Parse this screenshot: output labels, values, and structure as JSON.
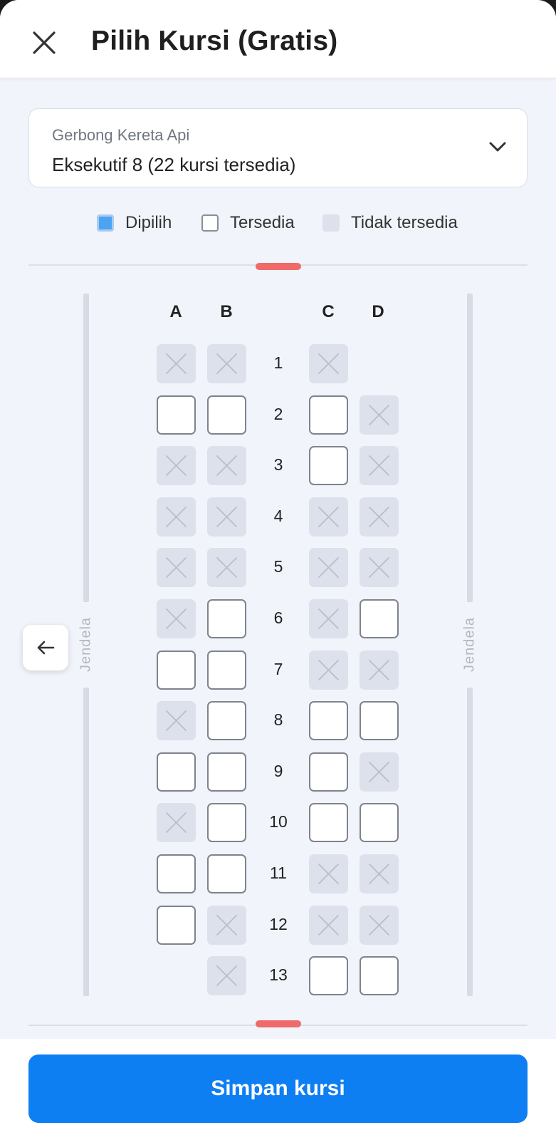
{
  "header": {
    "title": "Pilih Kursi (Gratis)"
  },
  "coach_select": {
    "label": "Gerbong Kereta Api",
    "value": "Eksekutif 8 (22 kursi tersedia)"
  },
  "legend": {
    "selected": "Dipilih",
    "available": "Tersedia",
    "unavailable": "Tidak tersedia"
  },
  "window_label": "Jendela",
  "columns": [
    "A",
    "B",
    "C",
    "D"
  ],
  "rows": [
    {
      "num": "1",
      "seats": [
        "unavailable",
        "unavailable",
        "unavailable",
        "none"
      ]
    },
    {
      "num": "2",
      "seats": [
        "available",
        "available",
        "available",
        "unavailable"
      ]
    },
    {
      "num": "3",
      "seats": [
        "unavailable",
        "unavailable",
        "available",
        "unavailable"
      ]
    },
    {
      "num": "4",
      "seats": [
        "unavailable",
        "unavailable",
        "unavailable",
        "unavailable"
      ]
    },
    {
      "num": "5",
      "seats": [
        "unavailable",
        "unavailable",
        "unavailable",
        "unavailable"
      ]
    },
    {
      "num": "6",
      "seats": [
        "unavailable",
        "available",
        "unavailable",
        "available"
      ]
    },
    {
      "num": "7",
      "seats": [
        "available",
        "available",
        "unavailable",
        "unavailable"
      ]
    },
    {
      "num": "8",
      "seats": [
        "unavailable",
        "available",
        "available",
        "available"
      ]
    },
    {
      "num": "9",
      "seats": [
        "available",
        "available",
        "available",
        "unavailable"
      ]
    },
    {
      "num": "10",
      "seats": [
        "unavailable",
        "available",
        "available",
        "available"
      ]
    },
    {
      "num": "11",
      "seats": [
        "available",
        "available",
        "unavailable",
        "unavailable"
      ]
    },
    {
      "num": "12",
      "seats": [
        "available",
        "unavailable",
        "unavailable",
        "unavailable"
      ]
    },
    {
      "num": "13",
      "seats": [
        "none",
        "unavailable",
        "available",
        "available"
      ]
    }
  ],
  "save_button": "Simpan kursi",
  "colors": {
    "primary": "#0d7ff2",
    "selected": "#4ea2f3",
    "unavailable": "#dde1eb",
    "background": "#f1f4fa",
    "marker": "#f06a6a"
  },
  "icons": {
    "close": "close-icon",
    "chevron": "chevron-down-icon",
    "back": "arrow-left-icon",
    "unavailable_mark": "x-mark-icon"
  }
}
